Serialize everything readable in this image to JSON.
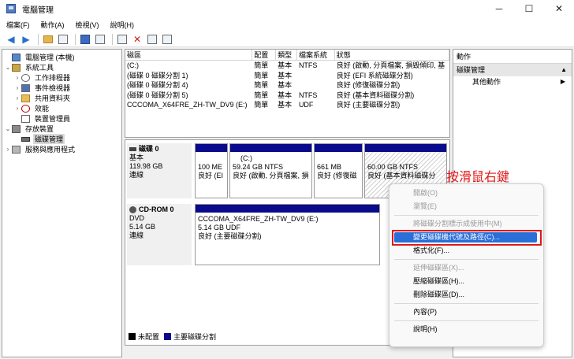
{
  "window": {
    "title": "電腦管理",
    "minimize": "─",
    "maximize": "☐",
    "close": "✕"
  },
  "menu": [
    "檔案(F)",
    "動作(A)",
    "檢視(V)",
    "說明(H)"
  ],
  "tree": [
    {
      "label": "電腦管理 (本機)",
      "icon": "computer-icon",
      "twisty": ""
    },
    {
      "label": "系統工具",
      "icon": "tools-icon",
      "twisty": "⌄"
    },
    {
      "label": "工作排程器",
      "icon": "clock-icon",
      "twisty": "›"
    },
    {
      "label": "事件檢視器",
      "icon": "event-icon",
      "twisty": "›"
    },
    {
      "label": "共用資料夾",
      "icon": "folder-icon",
      "twisty": "›"
    },
    {
      "label": "效能",
      "icon": "performance-icon",
      "twisty": "›"
    },
    {
      "label": "裝置管理員",
      "icon": "device-icon",
      "twisty": ""
    },
    {
      "label": "存放裝置",
      "icon": "storage-icon",
      "twisty": "⌄"
    },
    {
      "label": "磁碟管理",
      "icon": "disk-icon",
      "twisty": ""
    },
    {
      "label": "服務與應用程式",
      "icon": "services-icon",
      "twisty": "›"
    }
  ],
  "volume_list": {
    "headers": [
      "磁區",
      "配置",
      "類型",
      "檔案系統",
      "狀態"
    ],
    "rows": [
      [
        "(C:)",
        "簡單",
        "基本",
        "NTFS",
        "良好 (啟動, 分頁檔案, 損毀傾印, 基"
      ],
      [
        "(磁碟 0 磁碟分割 1)",
        "簡單",
        "基本",
        "",
        "良好 (EFI 系統磁碟分割)"
      ],
      [
        "(磁碟 0 磁碟分割 4)",
        "簡單",
        "基本",
        "",
        "良好 (修復磁碟分割)"
      ],
      [
        "(磁碟 0 磁碟分割 5)",
        "簡單",
        "基本",
        "NTFS",
        "良好 (基本資料磁碟分割)"
      ],
      [
        "CCCOMA_X64FRE_ZH-TW_DV9 (E:)",
        "簡單",
        "基本",
        "UDF",
        "良好 (主要磁碟分割)"
      ]
    ]
  },
  "disks": {
    "disk0": {
      "name": "磁碟 0",
      "type": "基本",
      "size": "119.98 GB",
      "status": "連線",
      "partitions": [
        {
          "l1": "",
          "l2": "100 ME",
          "l3": "良好 (EI"
        },
        {
          "l1": "(C:)",
          "l2": "59.24 GB NTFS",
          "l3": "良好 (啟動, 分頁檔案, 損"
        },
        {
          "l1": "",
          "l2": "661 MB",
          "l3": "良好 (修復磁"
        },
        {
          "l1": "",
          "l2": "60.00 GB NTFS",
          "l3": "良好 (基本資料磁碟分"
        }
      ]
    },
    "cdrom0": {
      "name": "CD-ROM 0",
      "type": "DVD",
      "size": "5.14 GB",
      "status": "連線",
      "partition": {
        "l1": "CCCOMA_X64FRE_ZH-TW_DV9 (E:)",
        "l2": "5.14 GB UDF",
        "l3": "良好 (主要磁碟分割)"
      }
    }
  },
  "legend": {
    "unallocated": "未配置",
    "primary": "主要磁碟分割",
    "unallocated_color": "#000000",
    "primary_color": "#0a0a8c"
  },
  "actions": {
    "title": "動作",
    "section": "磁碟管理",
    "more": "其他動作"
  },
  "annotation": "按滑鼠右鍵",
  "context_menu": {
    "open": "開啟(O)",
    "explore": "瀏覽(E)",
    "mark_active": "將磁碟分割標示成使用中(M)",
    "change_letter": "變更磁碟機代號及路徑(C)...",
    "format": "格式化(F)...",
    "extend": "延伸磁碟區(X)...",
    "shrink": "壓縮磁碟區(H)...",
    "delete": "刪除磁碟區(D)...",
    "properties": "內容(P)",
    "help": "說明(H)"
  },
  "colors": {
    "partition_band": "#0a0a8c",
    "highlight": "#2a6ed8",
    "annotation": "#e11818"
  }
}
